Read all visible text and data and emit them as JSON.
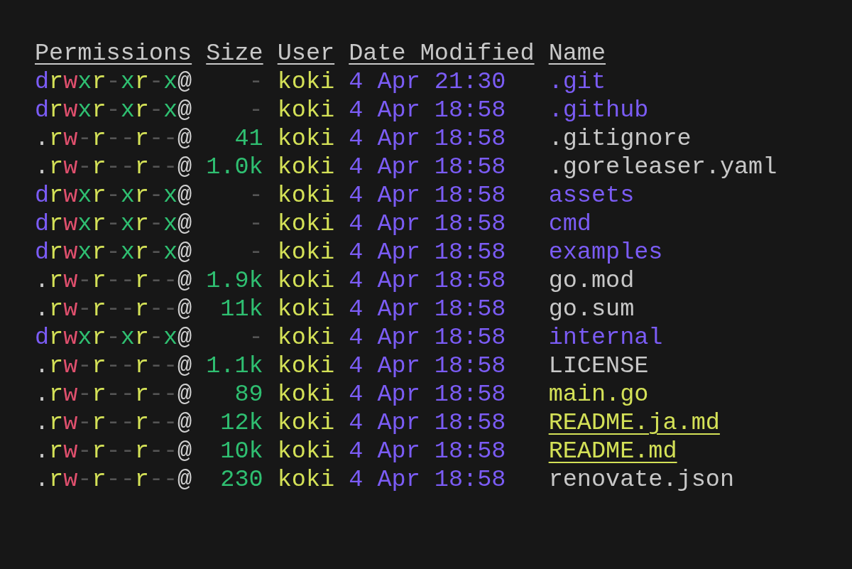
{
  "columns": [
    "Permissions",
    "Size",
    "User",
    "Date Modified",
    "Name"
  ],
  "rows": [
    {
      "permissions": "drwxr-xr-x@",
      "size": "-",
      "user": "koki",
      "date": "4 Apr 21:30",
      "name": ".git",
      "kind": "dir"
    },
    {
      "permissions": "drwxr-xr-x@",
      "size": "-",
      "user": "koki",
      "date": "4 Apr 18:58",
      "name": ".github",
      "kind": "dir"
    },
    {
      "permissions": ".rw-r--r--@",
      "size": "41",
      "user": "koki",
      "date": "4 Apr 18:58",
      "name": ".gitignore",
      "kind": "file"
    },
    {
      "permissions": ".rw-r--r--@",
      "size": "1.0k",
      "user": "koki",
      "date": "4 Apr 18:58",
      "name": ".goreleaser.yaml",
      "kind": "file"
    },
    {
      "permissions": "drwxr-xr-x@",
      "size": "-",
      "user": "koki",
      "date": "4 Apr 18:58",
      "name": "assets",
      "kind": "dir"
    },
    {
      "permissions": "drwxr-xr-x@",
      "size": "-",
      "user": "koki",
      "date": "4 Apr 18:58",
      "name": "cmd",
      "kind": "dir"
    },
    {
      "permissions": "drwxr-xr-x@",
      "size": "-",
      "user": "koki",
      "date": "4 Apr 18:58",
      "name": "examples",
      "kind": "dir"
    },
    {
      "permissions": ".rw-r--r--@",
      "size": "1.9k",
      "user": "koki",
      "date": "4 Apr 18:58",
      "name": "go.mod",
      "kind": "file"
    },
    {
      "permissions": ".rw-r--r--@",
      "size": "11k",
      "user": "koki",
      "date": "4 Apr 18:58",
      "name": "go.sum",
      "kind": "file"
    },
    {
      "permissions": "drwxr-xr-x@",
      "size": "-",
      "user": "koki",
      "date": "4 Apr 18:58",
      "name": "internal",
      "kind": "dir"
    },
    {
      "permissions": ".rw-r--r--@",
      "size": "1.1k",
      "user": "koki",
      "date": "4 Apr 18:58",
      "name": "LICENSE",
      "kind": "file"
    },
    {
      "permissions": ".rw-r--r--@",
      "size": "89",
      "user": "koki",
      "date": "4 Apr 18:58",
      "name": "main.go",
      "kind": "source"
    },
    {
      "permissions": ".rw-r--r--@",
      "size": "12k",
      "user": "koki",
      "date": "4 Apr 18:58",
      "name": "README.ja.md",
      "kind": "readme"
    },
    {
      "permissions": ".rw-r--r--@",
      "size": "10k",
      "user": "koki",
      "date": "4 Apr 18:58",
      "name": "README.md",
      "kind": "readme"
    },
    {
      "permissions": ".rw-r--r--@",
      "size": "230",
      "user": "koki",
      "date": "4 Apr 18:58",
      "name": "renovate.json",
      "kind": "file"
    }
  ]
}
